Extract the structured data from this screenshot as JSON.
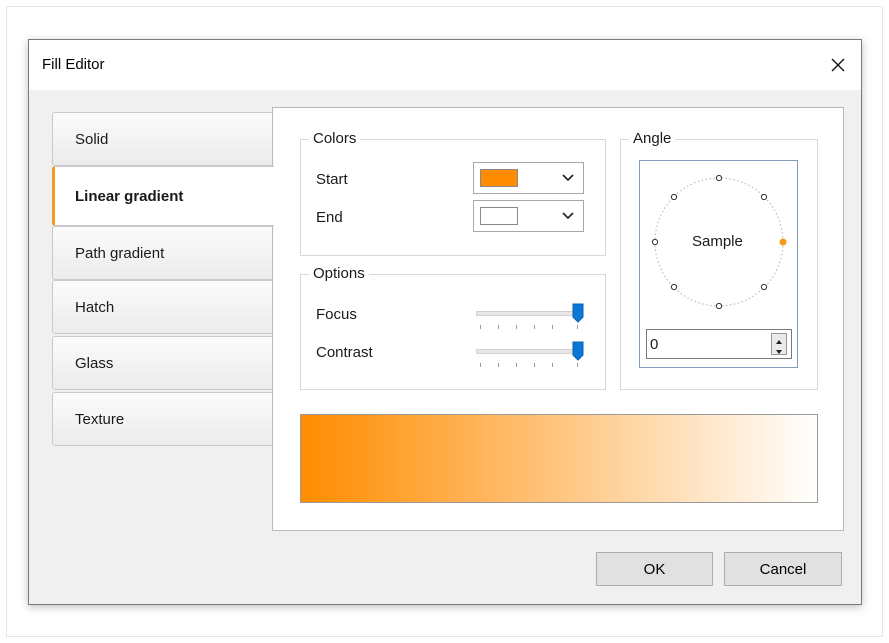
{
  "window": {
    "title": "Fill Editor"
  },
  "tabs": [
    {
      "label": "Solid",
      "active": false
    },
    {
      "label": "Linear gradient",
      "active": true
    },
    {
      "label": "Path gradient",
      "active": false
    },
    {
      "label": "Hatch",
      "active": false
    },
    {
      "label": "Glass",
      "active": false
    },
    {
      "label": "Texture",
      "active": false
    }
  ],
  "colors": {
    "title": "Colors",
    "start_label": "Start",
    "end_label": "End",
    "start_color": "#ff8c00",
    "end_color": "#ffffff"
  },
  "options": {
    "title": "Options",
    "focus_label": "Focus",
    "contrast_label": "Contrast",
    "focus_level": 1.0,
    "contrast_level": 1.0
  },
  "angle": {
    "title": "Angle",
    "sample_text": "Sample",
    "value": "0",
    "accent_color": "#f39a1b"
  },
  "preview": {
    "start_color": "#ff8c00",
    "end_color": "#ffffff"
  },
  "buttons": {
    "ok": "OK",
    "cancel": "Cancel"
  },
  "icons": {
    "close": "close-icon",
    "dropdown": "chevron-down-icon",
    "spin": "spin-arrows-icon"
  }
}
